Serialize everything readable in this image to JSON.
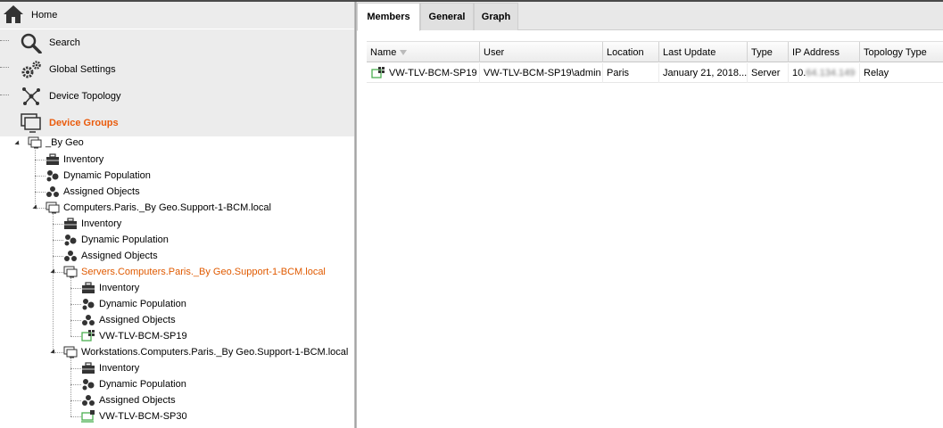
{
  "nav": {
    "home": "Home",
    "search": "Search",
    "global_settings": "Global Settings",
    "device_topology": "Device Topology",
    "device_groups": "Device Groups"
  },
  "tree": {
    "by_geo": "_By Geo",
    "inventory": "Inventory",
    "dynamic_population": "Dynamic Population",
    "assigned_objects": "Assigned Objects",
    "computers_paris": "Computers.Paris._By Geo.Support-1-BCM.local",
    "servers_paris": "Servers.Computers.Paris._By Geo.Support-1-BCM.local",
    "server_device": "VW-TLV-BCM-SP19",
    "workstations_paris": "Workstations.Computers.Paris._By Geo.Support-1-BCM.local",
    "workstation_device": "VW-TLV-BCM-SP30"
  },
  "tabs": {
    "members": "Members",
    "general": "General",
    "graph": "Graph"
  },
  "grid": {
    "columns": [
      "Name",
      "User",
      "Location",
      "Last Update",
      "Type",
      "IP Address",
      "Topology Type"
    ],
    "row": {
      "name": "VW-TLV-BCM-SP19",
      "user": "VW-TLV-BCM-SP19\\admin",
      "location": "Paris",
      "last_update": "January 21, 2018...",
      "type": "Server",
      "ip_prefix": "10.",
      "ip_blurred": "64.134.149",
      "topology_type": "Relay"
    }
  },
  "colors": {
    "accent_orange": "#ea5b0c",
    "tree_orange": "#e05a00",
    "nav_bg": "#ececec",
    "device_green": "#4caf50"
  }
}
